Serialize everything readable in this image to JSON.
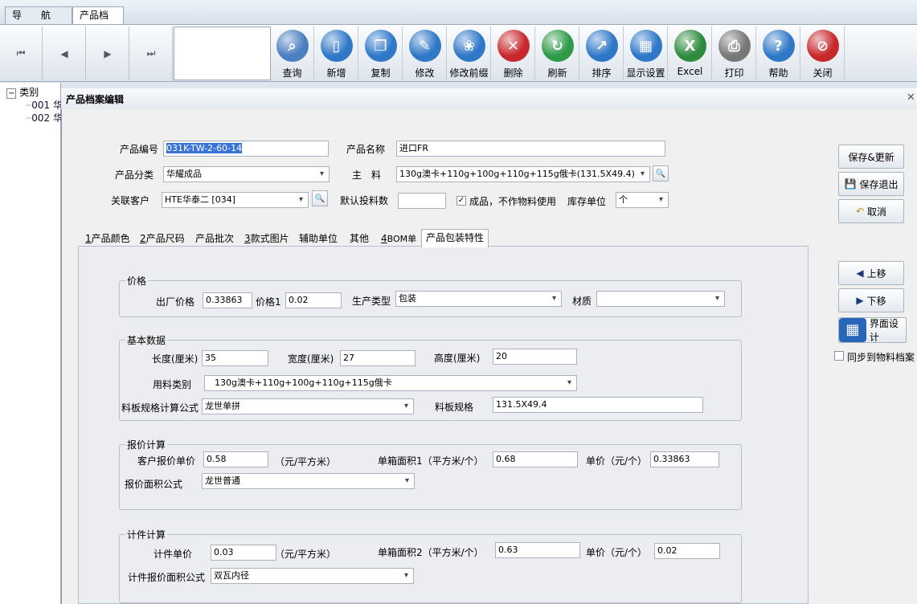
{
  "top_tabs": [
    "导　　航",
    "产品档案"
  ],
  "nav_buttons": [
    "⏮",
    "◀",
    "▶",
    "⏭"
  ],
  "toolbar": [
    {
      "label": "查询",
      "icon": "search-icon",
      "color": "#4b7fc1"
    },
    {
      "label": "新增",
      "icon": "new-doc-icon",
      "color": "#2f78c8"
    },
    {
      "label": "复制",
      "icon": "copy-icon",
      "color": "#2f78c8"
    },
    {
      "label": "修改",
      "icon": "edit-icon",
      "color": "#2f78c8"
    },
    {
      "label": "修改前缀",
      "icon": "paw-icon",
      "color": "#2f78c8"
    },
    {
      "label": "删除",
      "icon": "delete-x-icon",
      "color": "#c8282c"
    },
    {
      "label": "刷新",
      "icon": "refresh-icon",
      "color": "#2e9a48"
    },
    {
      "label": "排序",
      "icon": "sort-chart-icon",
      "color": "#2f78c8"
    },
    {
      "label": "显示设置",
      "icon": "grid-settings-icon",
      "color": "#2f78c8"
    },
    {
      "label": "Excel",
      "icon": "excel-icon",
      "color": "#2e8b3e"
    },
    {
      "label": "打印",
      "icon": "printer-icon",
      "color": "#777777"
    },
    {
      "label": "帮助",
      "icon": "help-icon",
      "color": "#2f78c8"
    },
    {
      "label": "关闭",
      "icon": "close-stop-icon",
      "color": "#c8282c"
    }
  ],
  "tree": {
    "root": "类别",
    "items": [
      "001 华",
      "002 华"
    ]
  },
  "dialog": {
    "title": "产品档案编辑",
    "product_code_label": "产品编号",
    "product_code": "031K-TW-2-60-14",
    "product_name_label": "产品名称",
    "product_name": "进口FR",
    "category_label": "产品分类",
    "category": "华耀成品",
    "material_label": "主　料",
    "material": "130g澳卡+110g+100g+110g+115g俄卡(131.5X49.4)",
    "customer_label": "关联客户",
    "customer": "HTE华泰二 [034]",
    "default_qty_label": "默认投料数",
    "default_qty": "",
    "finished_check_label": "成品，不作物料使用",
    "stock_unit_label": "库存单位",
    "stock_unit": "个"
  },
  "tabs": [
    {
      "num": "1",
      "text": "产品颜色"
    },
    {
      "num": "2",
      "text": "产品尺码"
    },
    {
      "num": "",
      "text": "产品批次"
    },
    {
      "num": "3",
      "text": "款式图片"
    },
    {
      "num": "",
      "text": "辅助单位"
    },
    {
      "num": "",
      "text": "其他"
    },
    {
      "num": "4",
      "text": "BOM单"
    },
    {
      "num": "",
      "text": "产品包装特性"
    }
  ],
  "price": {
    "title": "价格",
    "factory_price_label": "出厂价格",
    "factory_price": "0.33863",
    "price1_label": "价格1",
    "price1": "0.02",
    "prod_type_label": "生产类型",
    "prod_type": "包装",
    "texture_label": "材质",
    "texture": ""
  },
  "basic": {
    "title": "基本数据",
    "length_label": "长度(厘米)",
    "length": "35",
    "width_label": "宽度(厘米)",
    "width": "27",
    "height_label": "高度(厘米)",
    "height": "20",
    "mat_type_label": "用料类别",
    "mat_type": "130g澳卡+110g+100g+110g+115g俄卡",
    "board_formula_label": "料板规格计算公式",
    "board_formula": "龙世单拼",
    "board_spec_label": "料板规格",
    "board_spec": "131.5X49.4"
  },
  "quote": {
    "title": "报价计算",
    "cust_unit_label": "客户报价单价",
    "cust_unit": "0.58",
    "unit1": "（元/平方米）",
    "box_area1_label": "单箱面积1（平方米/个）",
    "box_area1": "0.68",
    "unit_price_label": "单价（元/个）",
    "unit_price": "0.33863",
    "area_formula_label": "报价面积公式",
    "area_formula": "龙世普通"
  },
  "piece": {
    "title": "计件计算",
    "piece_unit_label": "计件单价",
    "piece_unit": "0.03",
    "unit2": "（元/平方米）",
    "box_area2_label": "单箱面积2（平方米/个）",
    "box_area2": "0.63",
    "unit_price_label": "单价（元/个）",
    "unit_price": "0.02",
    "piece_formula_label": "计件报价面积公式",
    "piece_formula": "双瓦内径"
  },
  "right_buttons": {
    "save_update": "保存&更新",
    "save_exit": "保存退出",
    "cancel": "取消",
    "move_up": "上移",
    "move_down": "下移",
    "ui_settings": "界面设计",
    "sync_label": "同步到物料档案"
  }
}
